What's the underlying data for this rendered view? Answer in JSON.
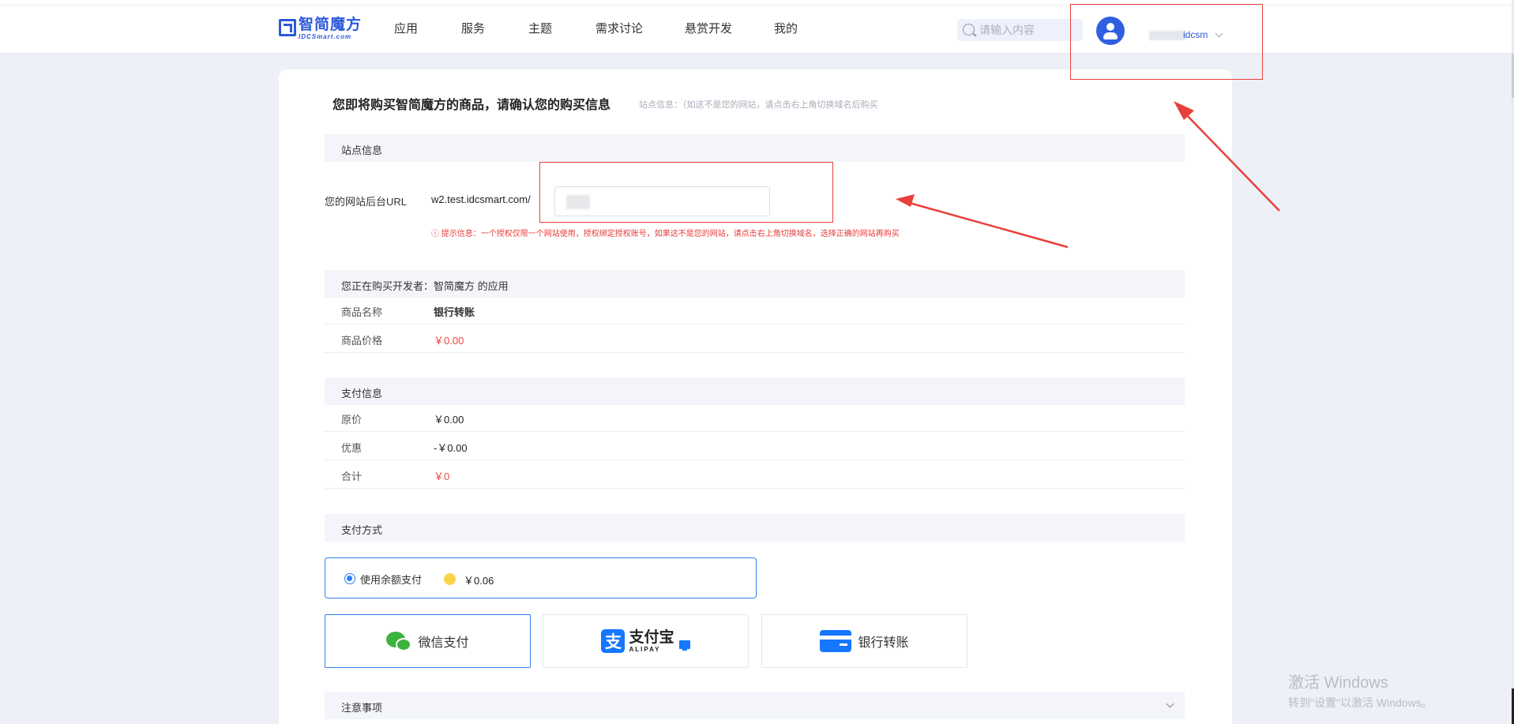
{
  "header": {
    "logo_cn": "智简魔方",
    "logo_en": "IDCSmart.com",
    "nav": [
      "应用",
      "服务",
      "主题",
      "需求讨论",
      "悬赏开发",
      "我的"
    ],
    "search_placeholder": "请输入内容",
    "user_name": "idcsm"
  },
  "page": {
    "title": "您即将购买智简魔方的商品，请确认您的购买信息",
    "site_hint": "站点信息：（如这不是您的网站，请点击右上角切换域名后购买"
  },
  "site_section": {
    "heading": "站点信息",
    "url_label": "您的网站后台URL",
    "url_prefix": "w2.test.idcsmart.com/",
    "tip": "ⓘ 提示信息：一个授权仅限一个网站使用，授权绑定授权账号，如果这不是您的网站，请点击右上角切换域名，选择正确的网站再购买"
  },
  "developer_section": {
    "heading": "您正在购买开发者：智简魔方 的应用",
    "rows": [
      {
        "label": "商品名称",
        "value": "银行转账"
      },
      {
        "label": "商品价格",
        "value": "￥0.00"
      }
    ]
  },
  "payment_info": {
    "heading": "支付信息",
    "rows": [
      {
        "label": "原价",
        "value": "￥0.00"
      },
      {
        "label": "优惠",
        "value": "-￥0.00"
      },
      {
        "label": "合计",
        "value": "￥0"
      }
    ]
  },
  "payment_method": {
    "heading": "支付方式",
    "balance_label": "使用余额支付",
    "balance_amount": "￥0.06",
    "options": [
      {
        "label": "微信支付",
        "icon": "wechat-icon",
        "selected": true
      },
      {
        "label": "支付宝",
        "sub": "ALIPAY",
        "icon": "alipay-icon",
        "selected": false
      },
      {
        "label": "银行转账",
        "icon": "bank-card-icon",
        "selected": false
      }
    ]
  },
  "notice": {
    "heading": "注意事项"
  },
  "watermark": {
    "title": "激活 Windows",
    "subtitle": "转到\"设置\"以激活 Windows。"
  },
  "colors": {
    "accent": "#2f7ff0",
    "brand": "#2b59d8",
    "price_red": "#f04343",
    "annotation_red": "#e8403a"
  }
}
